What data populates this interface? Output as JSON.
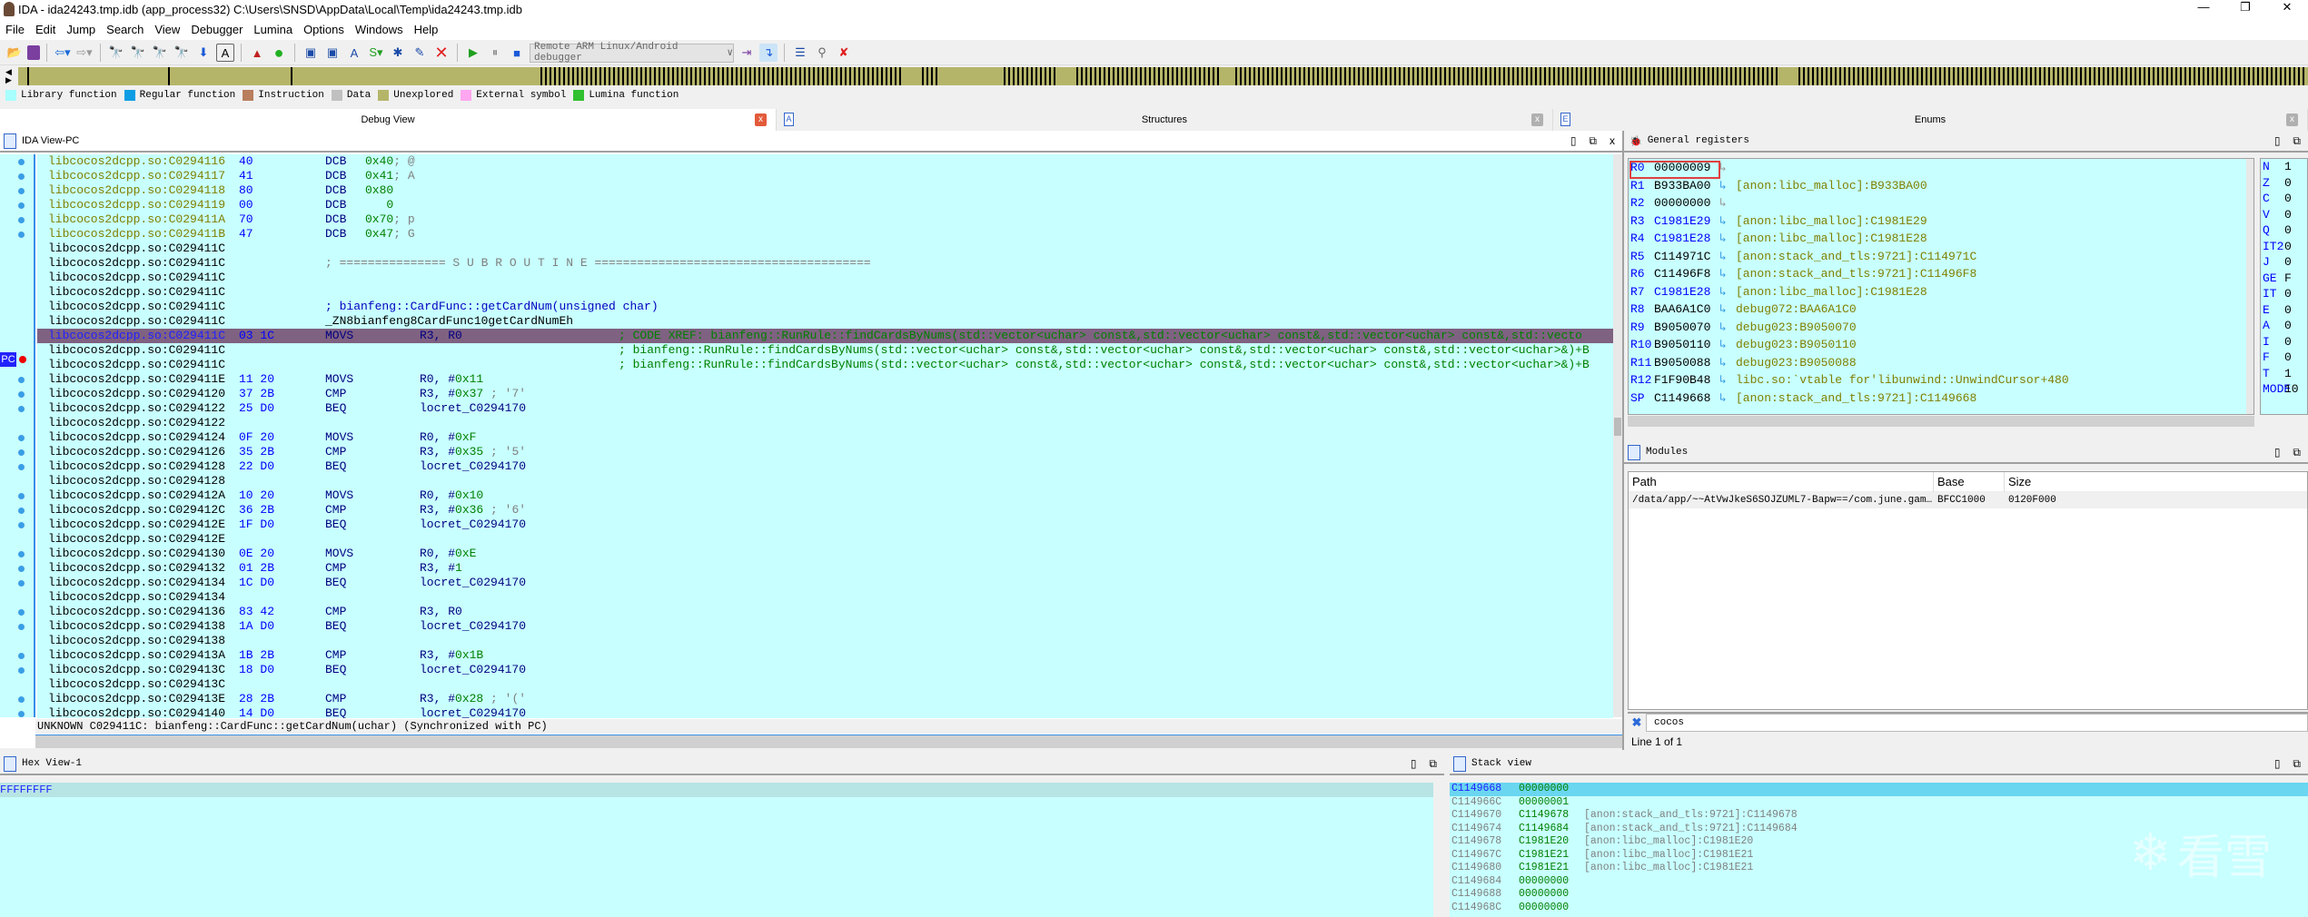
{
  "title": "IDA - ida24243.tmp.idb (app_process32) C:\\Users\\SNSD\\AppData\\Local\\Temp\\ida24243.tmp.idb",
  "window_controls": [
    "—",
    "❐",
    "✕"
  ],
  "menu": [
    "File",
    "Edit",
    "Jump",
    "Search",
    "View",
    "Debugger",
    "Lumina",
    "Options",
    "Windows",
    "Help"
  ],
  "toolbar": {
    "debugger_select": "Remote ARM Linux/Android debugger"
  },
  "legend": [
    {
      "label": "Library function",
      "color": "#a8ffff"
    },
    {
      "label": "Regular function",
      "color": "#0e9de4"
    },
    {
      "label": "Instruction",
      "color": "#b87e5e"
    },
    {
      "label": "Data",
      "color": "#c0c0c0"
    },
    {
      "label": "Unexplored",
      "color": "#b5b56a"
    },
    {
      "label": "External symbol",
      "color": "#ffa6f0"
    },
    {
      "label": "Lumina function",
      "color": "#30c030"
    }
  ],
  "tabs": [
    {
      "label": "Debug View",
      "active": true
    },
    {
      "label": "Structures",
      "active": false
    },
    {
      "label": "Enums",
      "active": false
    }
  ],
  "ida_view": {
    "title": "IDA View-PC",
    "pc_label": "PC",
    "lines": [
      {
        "a": "libcocos2dcpp.so:C0294116",
        "k": "data",
        "b": "40",
        "m": "DCB",
        "o": "",
        "i": "0x40",
        "c": "; @",
        "dot": 1
      },
      {
        "a": "libcocos2dcpp.so:C0294117",
        "k": "data",
        "b": "41",
        "m": "DCB",
        "o": "",
        "i": "0x41",
        "c": "; A",
        "dot": 1
      },
      {
        "a": "libcocos2dcpp.so:C0294118",
        "k": "data",
        "b": "80",
        "m": "DCB",
        "o": "",
        "i": "0x80",
        "c": "",
        "dot": 1
      },
      {
        "a": "libcocos2dcpp.so:C0294119",
        "k": "data",
        "b": "00",
        "m": "DCB",
        "o": "",
        "i": "   0",
        "c": "",
        "dot": 1
      },
      {
        "a": "libcocos2dcpp.so:C029411A",
        "k": "data",
        "b": "70",
        "m": "DCB",
        "o": "",
        "i": "0x70",
        "c": "; p",
        "dot": 1
      },
      {
        "a": "libcocos2dcpp.so:C029411B",
        "k": "data",
        "b": "47",
        "m": "DCB",
        "o": "",
        "i": "0x47",
        "c": "; G",
        "dot": 1
      },
      {
        "a": "libcocos2dcpp.so:C029411C",
        "k": "code"
      },
      {
        "a": "libcocos2dcpp.so:C029411C",
        "k": "code",
        "sub": "; =============== S U B R O U T I N E ======================================="
      },
      {
        "a": "libcocos2dcpp.so:C029411C",
        "k": "code"
      },
      {
        "a": "libcocos2dcpp.so:C029411C",
        "k": "code"
      },
      {
        "a": "libcocos2dcpp.so:C029411C",
        "k": "code",
        "fn": "; bianfeng::CardFunc::getCardNum(unsigned char)"
      },
      {
        "a": "libcocos2dcpp.so:C029411C",
        "k": "code",
        "lbl": "_ZN8bianfeng8CardFunc10getCardNumEh"
      },
      {
        "a": "libcocos2dcpp.so:C029411C",
        "k": "cur",
        "b": "03 1C",
        "m": "MOVS",
        "o": "R3, R0",
        "x": "; CODE XREF: bianfeng::RunRule::findCardsByNums(std::vector<uchar> const&,std::vector<uchar> const&,std::vector<uchar> const&,std::vecto"
      },
      {
        "a": "libcocos2dcpp.so:C029411C",
        "k": "code",
        "x": "; bianfeng::RunRule::findCardsByNums(std::vector<uchar> const&,std::vector<uchar> const&,std::vector<uchar> const&,std::vector<uchar>&)+B"
      },
      {
        "a": "libcocos2dcpp.so:C029411C",
        "k": "code",
        "x": "; bianfeng::RunRule::findCardsByNums(std::vector<uchar> const&,std::vector<uchar> const&,std::vector<uchar> const&,std::vector<uchar>&)+B"
      },
      {
        "a": "libcocos2dcpp.so:C029411E",
        "k": "code",
        "b": "11 20",
        "m": "MOVS",
        "o": "R0, #",
        "i": "0x11",
        "dot": 1
      },
      {
        "a": "libcocos2dcpp.so:C0294120",
        "k": "code",
        "b": "37 2B",
        "m": "CMP",
        "o": "R3, #",
        "i": "0x37",
        "c": " ; '7'",
        "dot": 1
      },
      {
        "a": "libcocos2dcpp.so:C0294122",
        "k": "code",
        "b": "25 D0",
        "m": "BEQ",
        "o": "locret_C0294170",
        "dot": 1
      },
      {
        "a": "libcocos2dcpp.so:C0294122",
        "k": "code"
      },
      {
        "a": "libcocos2dcpp.so:C0294124",
        "k": "code",
        "b": "0F 20",
        "m": "MOVS",
        "o": "R0, #",
        "i": "0xF",
        "dot": 1
      },
      {
        "a": "libcocos2dcpp.so:C0294126",
        "k": "code",
        "b": "35 2B",
        "m": "CMP",
        "o": "R3, #",
        "i": "0x35",
        "c": " ; '5'",
        "dot": 1
      },
      {
        "a": "libcocos2dcpp.so:C0294128",
        "k": "code",
        "b": "22 D0",
        "m": "BEQ",
        "o": "locret_C0294170",
        "dot": 1
      },
      {
        "a": "libcocos2dcpp.so:C0294128",
        "k": "code"
      },
      {
        "a": "libcocos2dcpp.so:C029412A",
        "k": "code",
        "b": "10 20",
        "m": "MOVS",
        "o": "R0, #",
        "i": "0x10",
        "dot": 1
      },
      {
        "a": "libcocos2dcpp.so:C029412C",
        "k": "code",
        "b": "36 2B",
        "m": "CMP",
        "o": "R3, #",
        "i": "0x36",
        "c": " ; '6'",
        "dot": 1
      },
      {
        "a": "libcocos2dcpp.so:C029412E",
        "k": "code",
        "b": "1F D0",
        "m": "BEQ",
        "o": "locret_C0294170",
        "dot": 1
      },
      {
        "a": "libcocos2dcpp.so:C029412E",
        "k": "code"
      },
      {
        "a": "libcocos2dcpp.so:C0294130",
        "k": "code",
        "b": "0E 20",
        "m": "MOVS",
        "o": "R0, #",
        "i": "0xE",
        "dot": 1
      },
      {
        "a": "libcocos2dcpp.so:C0294132",
        "k": "code",
        "b": "01 2B",
        "m": "CMP",
        "o": "R3, #",
        "i": "1",
        "dot": 1
      },
      {
        "a": "libcocos2dcpp.so:C0294134",
        "k": "code",
        "b": "1C D0",
        "m": "BEQ",
        "o": "locret_C0294170",
        "dot": 1
      },
      {
        "a": "libcocos2dcpp.so:C0294134",
        "k": "code"
      },
      {
        "a": "libcocos2dcpp.so:C0294136",
        "k": "code",
        "b": "83 42",
        "m": "CMP",
        "o": "R3, R0",
        "dot": 1
      },
      {
        "a": "libcocos2dcpp.so:C0294138",
        "k": "code",
        "b": "1A D0",
        "m": "BEQ",
        "o": "locret_C0294170",
        "dot": 1
      },
      {
        "a": "libcocos2dcpp.so:C0294138",
        "k": "code"
      },
      {
        "a": "libcocos2dcpp.so:C029413A",
        "k": "code",
        "b": "1B 2B",
        "m": "CMP",
        "o": "R3, #",
        "i": "0x1B",
        "dot": 1
      },
      {
        "a": "libcocos2dcpp.so:C029413C",
        "k": "code",
        "b": "18 D0",
        "m": "BEQ",
        "o": "locret_C0294170",
        "dot": 1
      },
      {
        "a": "libcocos2dcpp.so:C029413C",
        "k": "code"
      },
      {
        "a": "libcocos2dcpp.so:C029413E",
        "k": "code",
        "b": "28 2B",
        "m": "CMP",
        "o": "R3, #",
        "i": "0x28",
        "c": " ; '('",
        "dot": 1
      },
      {
        "a": "libcocos2dcpp.so:C0294140",
        "k": "code",
        "b": "14 D0",
        "m": "BEQ",
        "o": "locret_C0294170",
        "dot": 1
      }
    ],
    "status": {
      "kind": "UNKNOWN",
      "location": "C029411C: bianfeng::CardFunc::getCardNum(uchar)",
      "sync": "(Synchronized with PC)"
    }
  },
  "registers": {
    "title": "General registers",
    "rows": [
      {
        "n": "R0",
        "v": "00000009",
        "d": "",
        "ch": false,
        "ptr": false
      },
      {
        "n": "R1",
        "v": "B933BA00",
        "d": "[anon:libc_malloc]:B933BA00",
        "ch": false,
        "ptr": true
      },
      {
        "n": "R2",
        "v": "00000000",
        "d": "",
        "ch": false,
        "ptr": false
      },
      {
        "n": "R3",
        "v": "C1981E29",
        "d": "[anon:libc_malloc]:C1981E29",
        "ch": true,
        "ptr": true
      },
      {
        "n": "R4",
        "v": "C1981E28",
        "d": "[anon:libc_malloc]:C1981E28",
        "ch": true,
        "ptr": true
      },
      {
        "n": "R5",
        "v": "C114971C",
        "d": "[anon:stack_and_tls:9721]:C114971C",
        "ch": false,
        "ptr": true
      },
      {
        "n": "R6",
        "v": "C11496F8",
        "d": "[anon:stack_and_tls:9721]:C11496F8",
        "ch": false,
        "ptr": true
      },
      {
        "n": "R7",
        "v": "C1981E28",
        "d": "[anon:libc_malloc]:C1981E28",
        "ch": true,
        "ptr": true
      },
      {
        "n": "R8",
        "v": "BAA6A1C0",
        "d": "debug072:BAA6A1C0",
        "ch": false,
        "ptr": true
      },
      {
        "n": "R9",
        "v": "B9050070",
        "d": "debug023:B9050070",
        "ch": false,
        "ptr": true
      },
      {
        "n": "R10",
        "v": "B9050110",
        "d": "debug023:B9050110",
        "ch": false,
        "ptr": true
      },
      {
        "n": "R11",
        "v": "B9050088",
        "d": "debug023:B9050088",
        "ch": false,
        "ptr": true
      },
      {
        "n": "R12",
        "v": "F1F90B48",
        "d": "libc.so:`vtable for'libunwind::UnwindCursor+480",
        "ch": false,
        "ptr": true
      },
      {
        "n": "SP",
        "v": "C1149668",
        "d": "[anon:stack_and_tls:9721]:C1149668",
        "ch": false,
        "ptr": true
      }
    ],
    "arrow": "↳",
    "flags": [
      {
        "n": "N",
        "v": "1"
      },
      {
        "n": "Z",
        "v": "0"
      },
      {
        "n": "C",
        "v": "0"
      },
      {
        "n": "V",
        "v": "0"
      },
      {
        "n": "Q",
        "v": "0"
      },
      {
        "n": "IT2",
        "v": "0"
      },
      {
        "n": "J",
        "v": "0"
      },
      {
        "n": "GE",
        "v": "F"
      },
      {
        "n": "IT",
        "v": "0"
      },
      {
        "n": "E",
        "v": "0"
      },
      {
        "n": "A",
        "v": "0"
      },
      {
        "n": "I",
        "v": "0"
      },
      {
        "n": "F",
        "v": "0"
      },
      {
        "n": "T",
        "v": "1"
      },
      {
        "n": "MODE",
        "v": "10"
      }
    ]
  },
  "modules": {
    "title": "Modules",
    "columns": [
      "Path",
      "Base",
      "Size"
    ],
    "rows": [
      {
        "path": "/data/app/~~AtVwJkeS6SOJZUML7-Bapw==/com.june.gam…",
        "base": "BFCC1000",
        "size": "0120F000"
      }
    ],
    "filter": "cocos",
    "line_count": "Line 1 of 1"
  },
  "hex_view": {
    "title": "Hex View-1",
    "first_line": "FFFFFFFF"
  },
  "stack_view": {
    "title": "Stack view",
    "rows": [
      {
        "a": "C1149668",
        "v": "00000000",
        "d": ""
      },
      {
        "a": "C114966C",
        "v": "00000001",
        "d": ""
      },
      {
        "a": "C1149670",
        "v": "C1149678",
        "d": "[anon:stack_and_tls:9721]:C1149678"
      },
      {
        "a": "C1149674",
        "v": "C1149684",
        "d": "[anon:stack_and_tls:9721]:C1149684"
      },
      {
        "a": "C1149678",
        "v": "C1981E20",
        "d": "[anon:libc_malloc]:C1981E20"
      },
      {
        "a": "C114967C",
        "v": "C1981E21",
        "d": "[anon:libc_malloc]:C1981E21"
      },
      {
        "a": "C1149680",
        "v": "C1981E21",
        "d": "[anon:libc_malloc]:C1981E21"
      },
      {
        "a": "C1149684",
        "v": "00000000",
        "d": ""
      },
      {
        "a": "C1149688",
        "v": "00000000",
        "d": ""
      },
      {
        "a": "C114968C",
        "v": "00000000",
        "d": ""
      }
    ]
  },
  "watermark": "看雪"
}
